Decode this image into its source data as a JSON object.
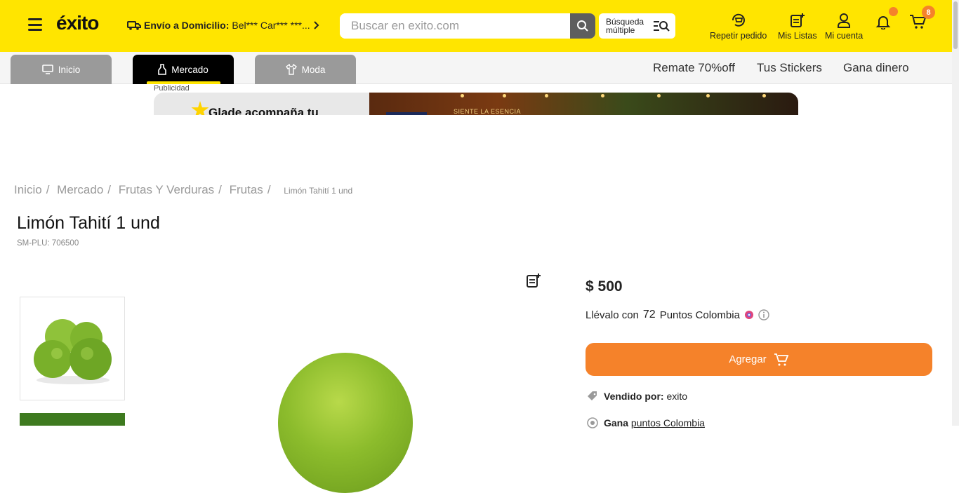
{
  "header": {
    "logo_text": "éxito",
    "delivery_label": "Envío a Domicilio:",
    "delivery_address": "Bel*** Car*** ***...",
    "search_placeholder": "Buscar en exito.com",
    "multi_search_line1": "Búsqueda",
    "multi_search_line2": "múltiple",
    "tools": {
      "repeat_order": "Repetir pedido",
      "my_lists": "Mis Listas",
      "my_account": "Mi cuenta"
    },
    "cart_count": "8",
    "colors": {
      "brand_yellow": "#ffe500",
      "accent_orange": "#f5822a"
    }
  },
  "nav": {
    "categories": [
      {
        "label": "Inicio",
        "icon": "monitor-icon"
      },
      {
        "label": "Mercado",
        "icon": "bottle-icon"
      },
      {
        "label": "Moda",
        "icon": "shirt-icon"
      }
    ],
    "links": [
      "Remate 70%off",
      "Tus Stickers",
      "Gana dinero"
    ]
  },
  "ad": {
    "label": "Publicidad",
    "headline": "Glade acompaña tu",
    "right_text": "SIENTE LA ESENCIA"
  },
  "breadcrumb": {
    "items": [
      "Inicio",
      "Mercado",
      "Frutas Y Verduras",
      "Frutas"
    ],
    "current": "Limón Tahití 1 und"
  },
  "product": {
    "title": "Limón Tahití 1 und",
    "plu": "SM-PLU: 706500",
    "price": "$ 500",
    "points_prefix": "Llévalo con",
    "points_value": "72",
    "points_suffix": "Puntos Colombia",
    "add_button": "Agregar",
    "seller_label": "Vendido por:",
    "seller_name": "exito",
    "earn_label": "Gana",
    "earn_link": "puntos Colombia"
  }
}
